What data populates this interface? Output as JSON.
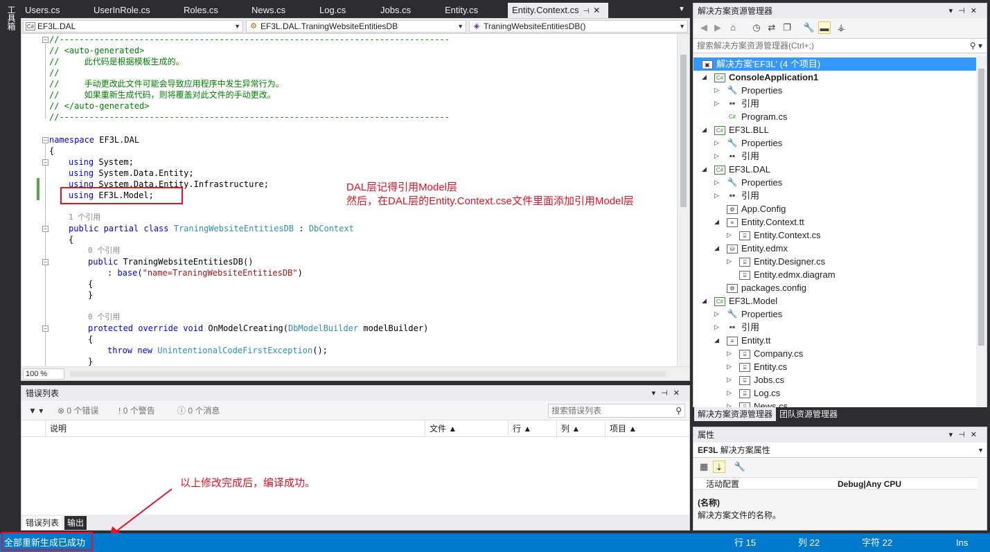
{
  "side_toolbox": {
    "label": "工具箱"
  },
  "tabs": [
    {
      "label": "Users.cs"
    },
    {
      "label": "UserInRole.cs"
    },
    {
      "label": "Roles.cs"
    },
    {
      "label": "News.cs"
    },
    {
      "label": "Log.cs"
    },
    {
      "label": "Jobs.cs"
    },
    {
      "label": "Entity.cs"
    },
    {
      "label": "Entity.Context.cs",
      "active": true
    }
  ],
  "nav": {
    "project": "EF3L.DAL",
    "class": "EF3L.DAL.TraningWebsiteEntitiesDB",
    "member": "TraningWebsiteEntitiesDB()"
  },
  "code": {
    "l1": "//------------------------------------------------------------------------------",
    "l2": "// <auto-generated>",
    "l3": "//     此代码是根据模板生成的。",
    "l4": "//",
    "l5": "//     手动更改此文件可能会导致应用程序中发生异常行为。",
    "l6": "//     如果重新生成代码，则将覆盖对此文件的手动更改。",
    "l7": "// </auto-generated>",
    "l8": "//------------------------------------------------------------------------------",
    "ns_kw": "namespace",
    "ns_name": " EF3L.DAL",
    "brace_open": "{",
    "brace_close": "}",
    "using_kw": "using",
    "u1": " System;",
    "u2": " System.Data.Entity;",
    "u3": " System.Data.Entity.Infrastructure;",
    "u4": " EF3L.Model;",
    "ref1": "1 个引用",
    "ref0": "0 个引用",
    "class_mods": "public partial class",
    "class_name": "TraningWebsiteEntitiesDB",
    "colon": " : ",
    "base_type": "DbContext",
    "ctor_kw": "public",
    "ctor_name": " TraningWebsiteEntitiesDB()",
    "base_pre": ": ",
    "base_kw": "base",
    "base_open": "(",
    "base_arg": "\"name=TraningWebsiteEntitiesDB\"",
    "base_close": ")",
    "override_kw": "protected override void",
    "method_name": " OnModelCreating(",
    "param_type": "DbModelBuilder",
    "param_name": " modelBuilder)",
    "throw_kw": "throw new",
    "exc_type": "UnintentionalCodeFirstException",
    "throw_end": "();"
  },
  "zoom": "100 %",
  "annotations": {
    "dal_line1": "DAL层记得引用Model层",
    "dal_line2": "然后，在DAL层的Entity.Context.cse文件里面添加引用Model层",
    "build_note": "以上修改完成后，编译成功。"
  },
  "error_list": {
    "title": "错误列表",
    "errors": "0 个错误",
    "warnings": "0 个警告",
    "messages": "0 个消息",
    "search_placeholder": "搜索错误列表",
    "columns": [
      "说明",
      "文件",
      "行",
      "列",
      "项目"
    ],
    "bottom_tabs": [
      "错误列表",
      "输出"
    ]
  },
  "solution_explorer": {
    "title": "解决方案资源管理器",
    "search_placeholder": "搜索解决方案资源管理器(Ctrl+;)",
    "tree": [
      {
        "label": "解决方案'EF3L' (4 个项目)"
      },
      {
        "label": "ConsoleApplication1"
      },
      {
        "label": "Properties"
      },
      {
        "label": "引用"
      },
      {
        "label": "Program.cs"
      },
      {
        "label": "EF3L.BLL"
      },
      {
        "label": "Properties"
      },
      {
        "label": "引用"
      },
      {
        "label": "EF3L.DAL"
      },
      {
        "label": "Properties"
      },
      {
        "label": "引用"
      },
      {
        "label": "App.Config"
      },
      {
        "label": "Entity.Context.tt"
      },
      {
        "label": "Entity.Context.cs"
      },
      {
        "label": "Entity.edmx"
      },
      {
        "label": "Entity.Designer.cs"
      },
      {
        "label": "Entity.edmx.diagram"
      },
      {
        "label": "packages.config"
      },
      {
        "label": "EF3L.Model"
      },
      {
        "label": "Properties"
      },
      {
        "label": "引用"
      },
      {
        "label": "Entity.tt"
      },
      {
        "label": "Company.cs"
      },
      {
        "label": "Entity.cs"
      },
      {
        "label": "Jobs.cs"
      },
      {
        "label": "Log.cs"
      },
      {
        "label": "News.cs"
      }
    ],
    "bottom_tabs": [
      "解决方案资源管理器",
      "团队资源管理器"
    ]
  },
  "properties": {
    "title": "属性",
    "object_name": "EF3L",
    "object_type": "解决方案属性",
    "row_name": "活动配置",
    "row_value": "Debug|Any CPU",
    "desc_title": "(名称)",
    "desc_text": "解决方案文件的名称。"
  },
  "status": {
    "message": "全部重新生成已成功",
    "line": "行 15",
    "col": "列 22",
    "char": "字符 22",
    "mode": "Ins"
  },
  "colors": {
    "accent": "#007acc",
    "annotation": "#e81123",
    "selection": "#3399ff"
  }
}
